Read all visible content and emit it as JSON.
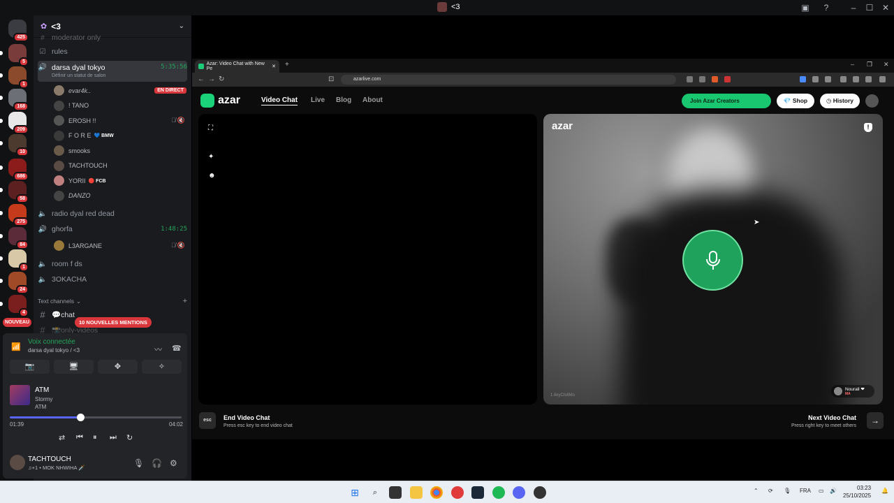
{
  "window": {
    "title": "<3"
  },
  "guilds": [
    {
      "name": "home",
      "color": "#3a3c41",
      "badge": "425"
    },
    {
      "name": "server-1",
      "color": "#7a3b3b",
      "badge": "5"
    },
    {
      "name": "server-2",
      "color": "#8b4a2b",
      "badge": "1"
    },
    {
      "name": "server-3",
      "color": "#6d6f76",
      "badge": "168"
    },
    {
      "name": "server-4",
      "color": "#e8e8e8",
      "badge": "209"
    },
    {
      "name": "server-5",
      "color": "#4c3a2e",
      "badge": "10"
    },
    {
      "name": "server-6",
      "color": "#8c1c1c",
      "badge": "686"
    },
    {
      "name": "server-7",
      "color": "#5c2020",
      "badge": "58"
    },
    {
      "name": "server-8",
      "color": "#c43a1a",
      "badge": "275"
    },
    {
      "name": "server-9",
      "color": "#5b2b3a",
      "badge": "84"
    },
    {
      "name": "server-10",
      "color": "#d8c8a8",
      "badge": "1"
    },
    {
      "name": "server-11",
      "color": "#a04a28",
      "badge": "24"
    },
    {
      "name": "server-12",
      "color": "#7a1e1e",
      "badge": "4"
    }
  ],
  "nouveau": "NOUVEAU",
  "server": {
    "name": "<3"
  },
  "channels": {
    "partial": "moderator only",
    "rules": "rules",
    "darsa": {
      "name": "darsa dyal tokyo",
      "time": "5:35:56",
      "status": "Définir un statut de salon"
    },
    "darsa_users": [
      {
        "name": "evar4k..",
        "live": "EN DIRECT",
        "color": "#8a7a6a"
      },
      {
        "name": "! TANO",
        "color": "#444"
      },
      {
        "name": "EROSH !!",
        "color": "#555",
        "muted": "true"
      },
      {
        "name": "F O R E",
        "tag": "💙 BMW",
        "color": "#3a3a3a"
      },
      {
        "name": "smooks",
        "color": "#6a5a4a"
      },
      {
        "name": "TACHTOUCH",
        "color": "#5b4b45"
      },
      {
        "name": "YORII",
        "tag": "🔴 FCB",
        "color": "#c08080"
      },
      {
        "name": "DANZO",
        "color": "#444"
      }
    ],
    "radio": "radio dyal red dead",
    "ghorfa": {
      "name": "ghorfa",
      "time": "1:48:25"
    },
    "ghorfa_user": {
      "name": "L3ARGANE",
      "color": "#9a7a3a"
    },
    "room": "room f ds",
    "okacha": "3OKACHA",
    "text_header": "Text channels",
    "chat": "💬chat",
    "only": "📸only-vidéos"
  },
  "mentions": "10 NOUVELLES MENTIONS",
  "voice": {
    "title": "Voix connectée",
    "subtitle": "darsa dyal tokyo / <3"
  },
  "music": {
    "title": "ATM",
    "artist": "Stormy",
    "album": "ATM",
    "elapsed": "01:39",
    "total": "04:02",
    "progress": 0.41
  },
  "user": {
    "name": "TACHTOUCH",
    "status": "♫+1 • MOK NHWIHA 🗡️"
  },
  "browser": {
    "tab_title": "Azar: Video Chat with New Pe",
    "url": "azarlive.com"
  },
  "azar": {
    "brand": "azar",
    "nav": [
      "Video Chat",
      "Live",
      "Blog",
      "About"
    ],
    "creators": "Join Azar Creators",
    "shop": "Shop",
    "history": "History",
    "watermark": "azar",
    "room_id": "1.6kyCIs6Mo",
    "partner_name": "Nourall ❤",
    "partner_country": "MA",
    "end_title": "End Video Chat",
    "end_sub": "Press esc key to end video chat",
    "esc": "esc",
    "next_title": "Next Video Chat",
    "next_sub": "Press right key to meet others"
  },
  "taskbar": {
    "lang": "FRA",
    "time": "03:23",
    "date": "25/10/2025"
  }
}
